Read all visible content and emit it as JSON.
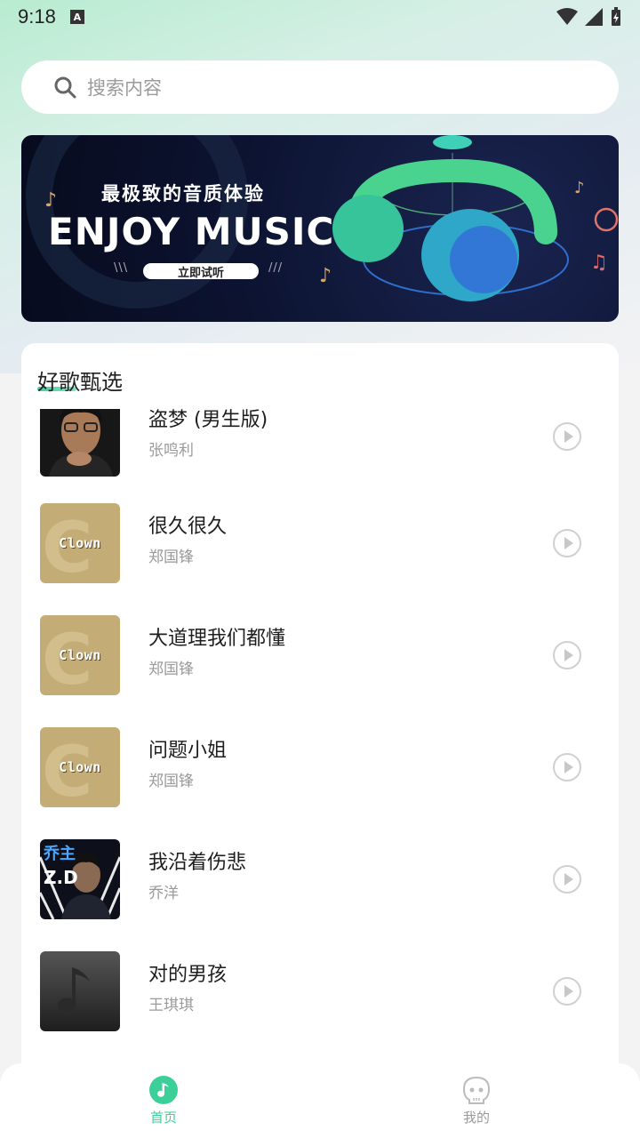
{
  "status": {
    "time": "9:18",
    "notification_letter": "A"
  },
  "search": {
    "placeholder": "搜索内容"
  },
  "banner": {
    "subtitle": "最极致的音质体验",
    "title": "ENJOY MUSIC",
    "button": "立即试听"
  },
  "section": {
    "title": "好歌甄选"
  },
  "songs": [
    {
      "title": "盗梦 (男生版)",
      "artist": "张鸣利",
      "cover": "portrait"
    },
    {
      "title": "很久很久",
      "artist": "郑国锋",
      "cover": "clown",
      "cover_text": "Clown"
    },
    {
      "title": "大道理我们都懂",
      "artist": "郑国锋",
      "cover": "clown",
      "cover_text": "Clown"
    },
    {
      "title": "问题小姐",
      "artist": "郑国锋",
      "cover": "clown",
      "cover_text": "Clown"
    },
    {
      "title": "我沿着伤悲",
      "artist": "乔洋",
      "cover": "zd",
      "cover_text": "乔主 Z.D"
    },
    {
      "title": "对的男孩",
      "artist": "王琪琪",
      "cover": "default-note"
    }
  ],
  "nav": {
    "home": {
      "label": "首页",
      "icon": "music-note-icon",
      "active": true
    },
    "mine": {
      "label": "我的",
      "icon": "profile-face-icon",
      "active": false
    }
  },
  "colors": {
    "accent": "#3ccf98",
    "inactive": "#9a9a9a"
  }
}
